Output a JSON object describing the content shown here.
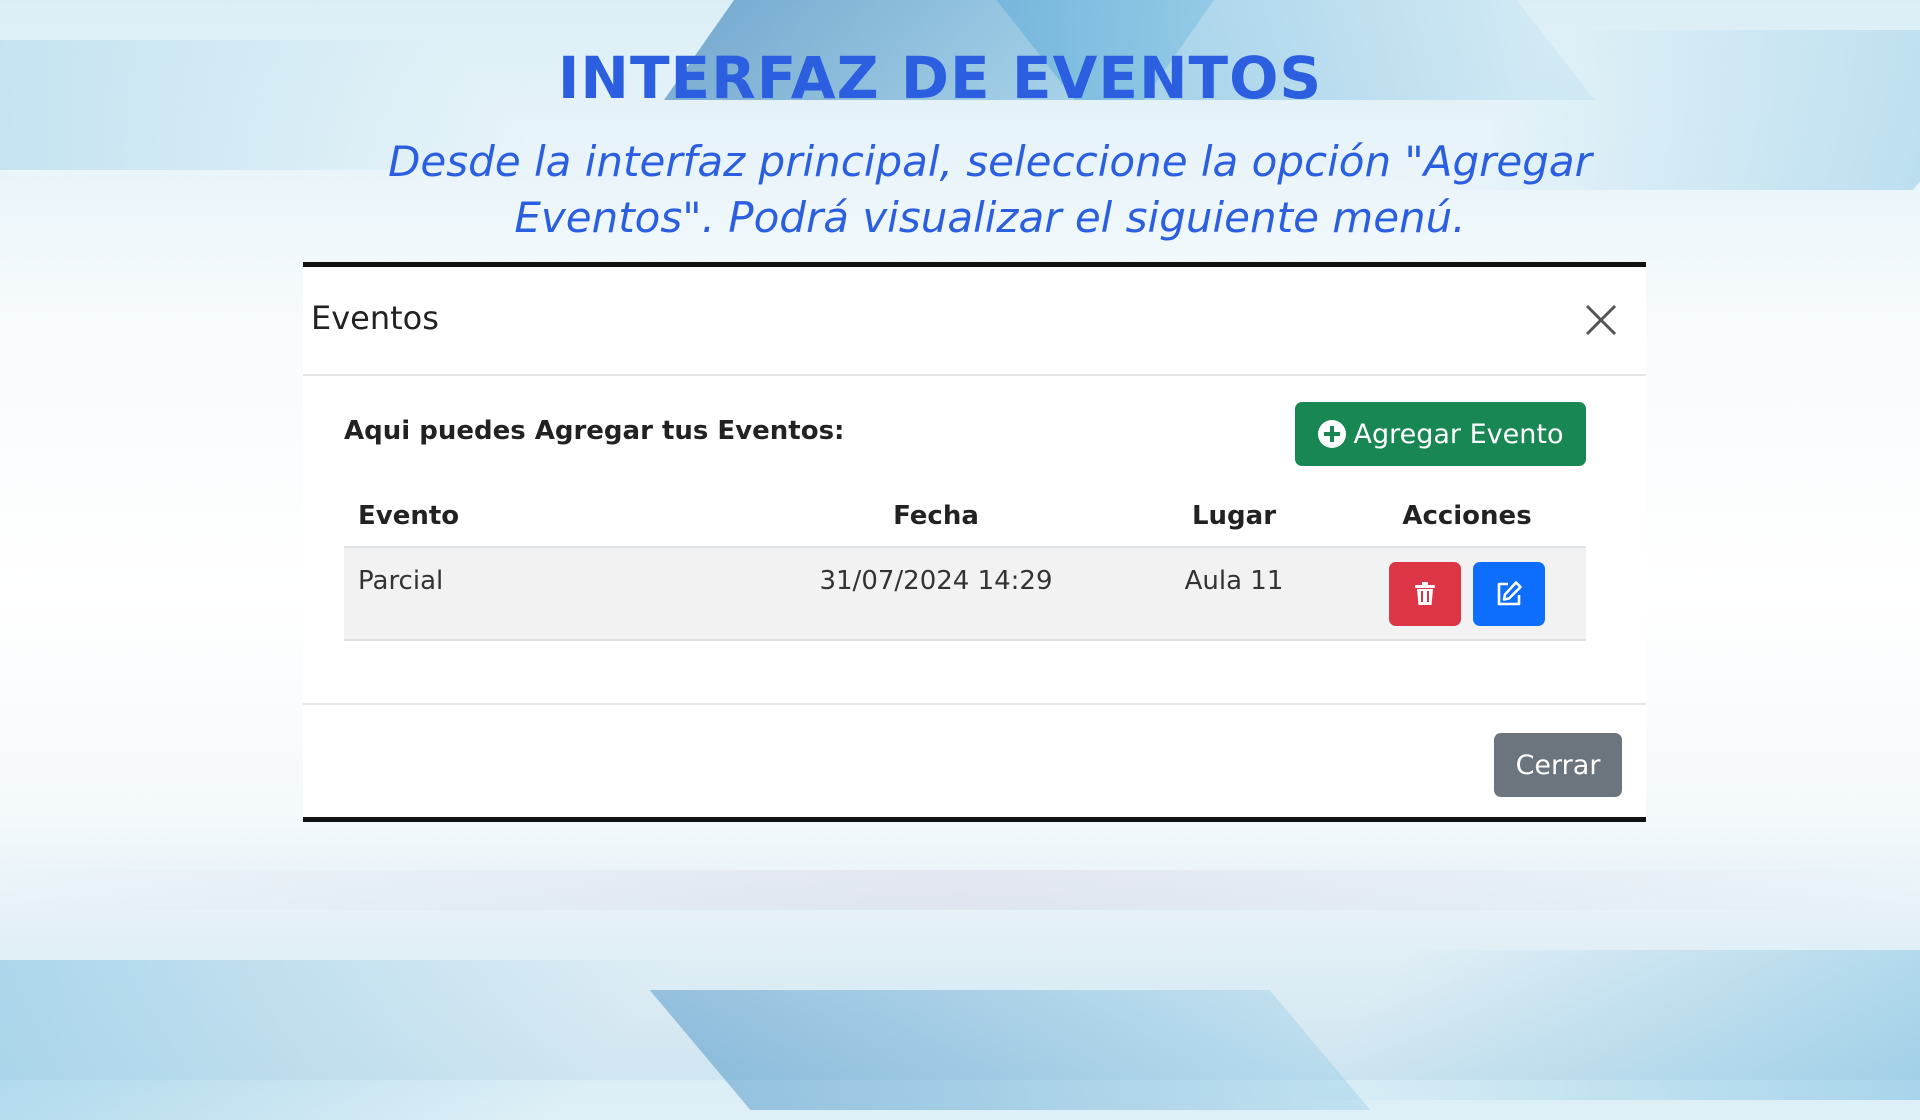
{
  "slide": {
    "title": "INTERFAZ DE EVENTOS",
    "subtitle": "Desde la interfaz principal, seleccione la opción \"Agregar Eventos\". Podrá visualizar el siguiente menú."
  },
  "modal": {
    "title": "Eventos",
    "close_icon": "close-icon",
    "intro": "Aqui puedes Agregar tus Eventos:",
    "add_button": {
      "label": "Agregar Evento",
      "icon": "plus-circle-icon",
      "color": "#198754"
    },
    "table": {
      "headers": [
        "Evento",
        "Fecha",
        "Lugar",
        "Acciones"
      ],
      "rows": [
        {
          "evento": "Parcial",
          "fecha": "31/07/2024 14:29",
          "lugar": "Aula 11"
        }
      ]
    },
    "actions": {
      "delete": {
        "icon": "trash-icon",
        "color": "#dc3545"
      },
      "edit": {
        "icon": "edit-icon",
        "color": "#0d6efd"
      }
    },
    "footer": {
      "close_label": "Cerrar",
      "color": "#6c757d"
    }
  },
  "colors": {
    "title_blue": "#2b5fe0"
  }
}
